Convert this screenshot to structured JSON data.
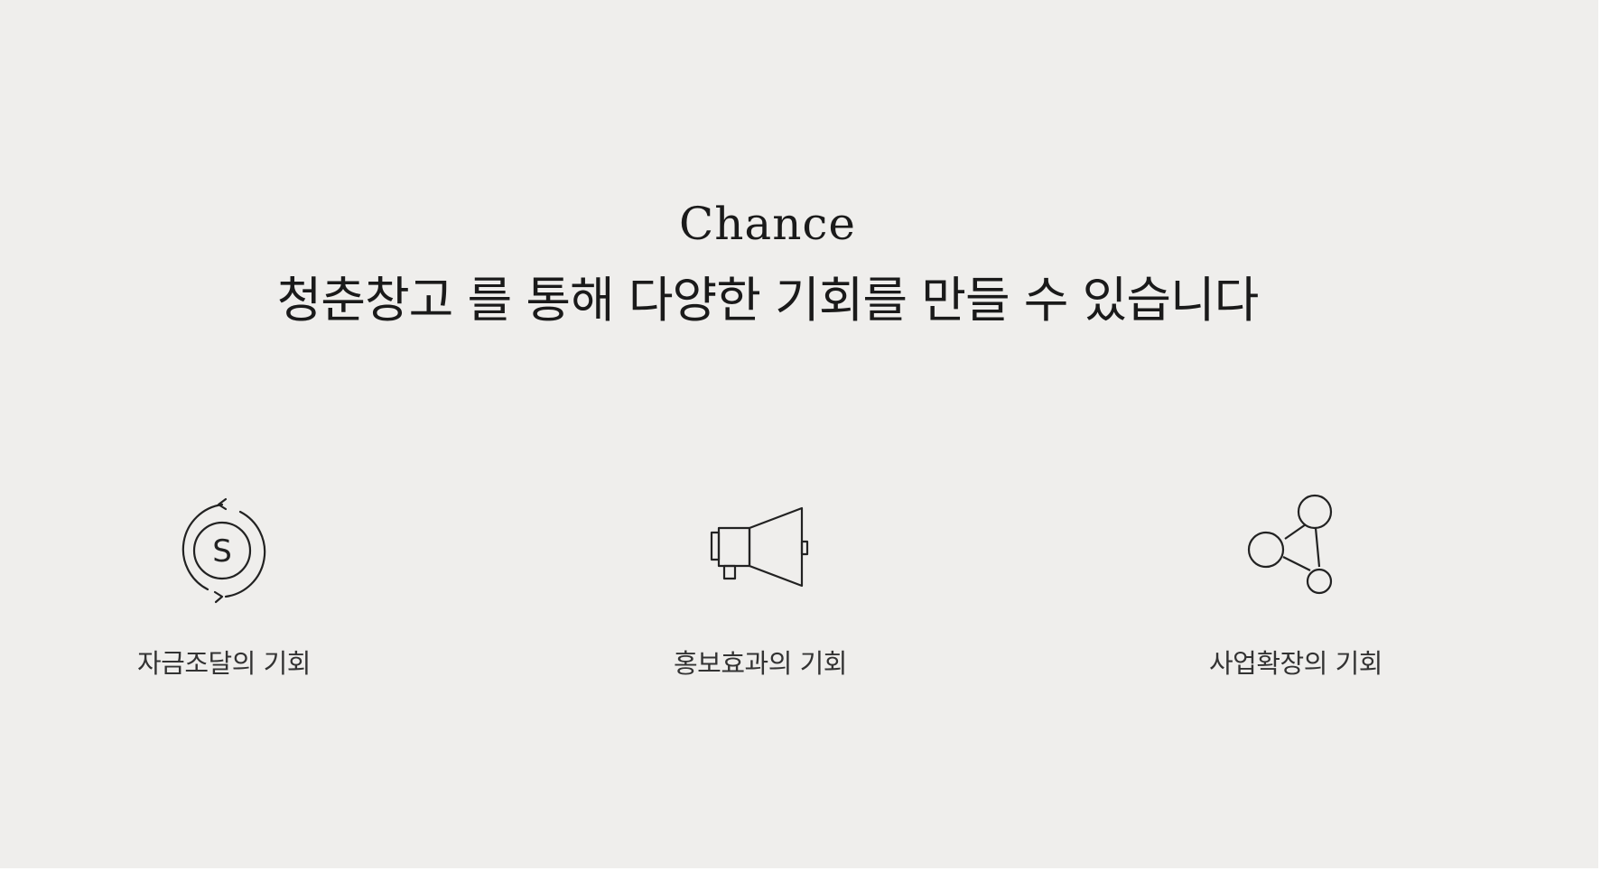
{
  "section": {
    "eyebrow": "Chance",
    "title": "청춘창고 를 통해 다양한 기회를 만들 수 있습니다"
  },
  "features": [
    {
      "label": "자금조달의 기회",
      "icon": "currency-cycle-icon"
    },
    {
      "label": "홍보효과의 기회",
      "icon": "megaphone-icon"
    },
    {
      "label": "사업확장의 기회",
      "icon": "network-icon"
    }
  ],
  "currency_symbol": "S",
  "colors": {
    "background": "#efeeec",
    "text": "#1a1a1a",
    "label": "#333333",
    "icon_stroke": "#222222"
  }
}
